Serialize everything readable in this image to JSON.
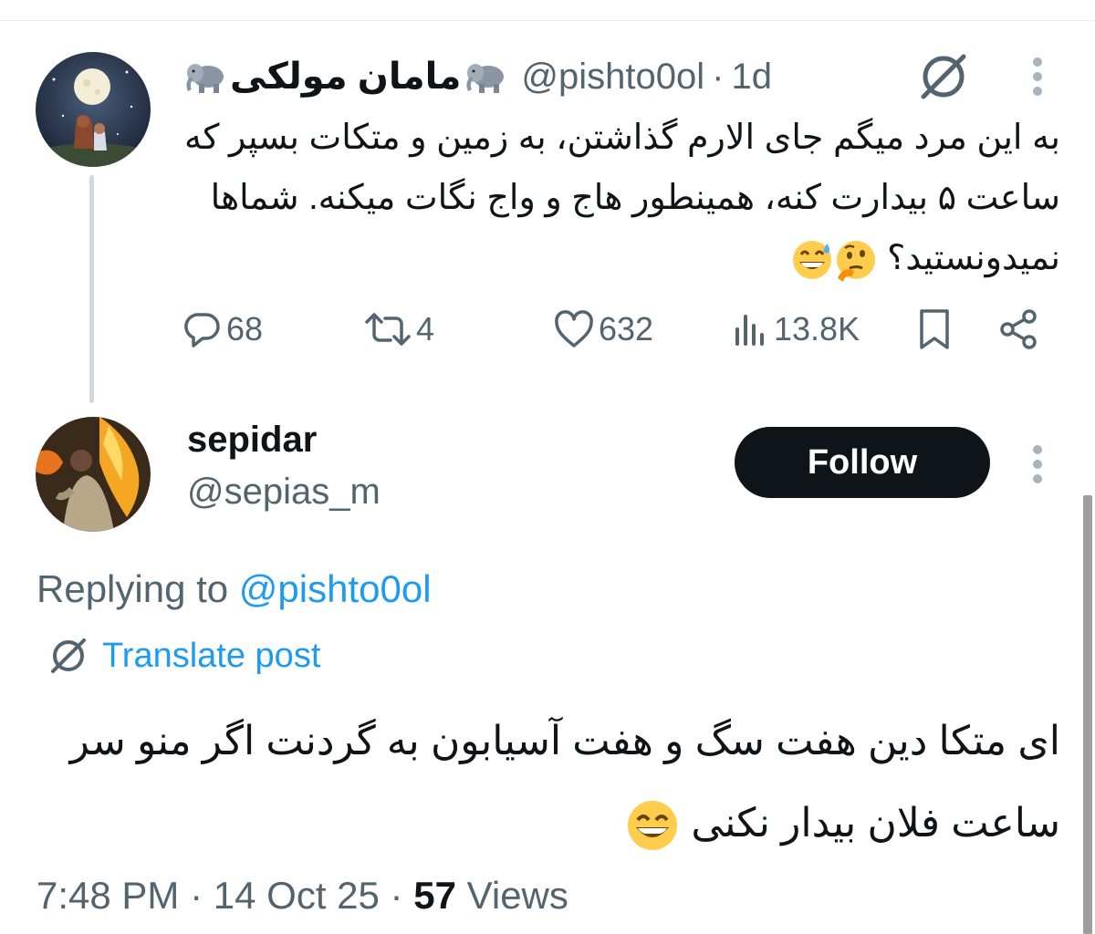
{
  "parent_tweet": {
    "display_name": "مامان مولکی",
    "handle": "@pishto0ol",
    "separator": "·",
    "time": "1d",
    "text": "به این مرد میگم جای الارم گذاشتن، به زمین و متکات بسپر که ساعت ۵ بیدارت کنه، همینطور هاج و واج نگات میکنه. شماها نمیدونستید؟",
    "emojis": [
      "thinking-face",
      "grinning-sweat-face"
    ],
    "actions": {
      "replies": "68",
      "reposts": "4",
      "likes": "632",
      "views": "13.8K"
    }
  },
  "reply_tweet": {
    "display_name": "sepidar",
    "handle": "@sepias_m",
    "follow_label": "Follow",
    "replying_prefix": "Replying to",
    "replying_handle": "@pishto0ol",
    "translate_label": "Translate post",
    "text": "ای متکا دین هفت سگ و هفت آسیابون به گردنت اگر منو سر ساعت فلان بیدار نکنی",
    "emojis": [
      "grinning-squinting-face"
    ],
    "time": "7:48 PM",
    "date": "14 Oct 25",
    "separator": "·",
    "views_count": "57",
    "views_label": "Views"
  },
  "colors": {
    "text": "#0f1419",
    "muted": "#536471",
    "accent": "#1d9bf0",
    "follow_bg": "#0f1419",
    "thread_line": "#cfd9de"
  }
}
